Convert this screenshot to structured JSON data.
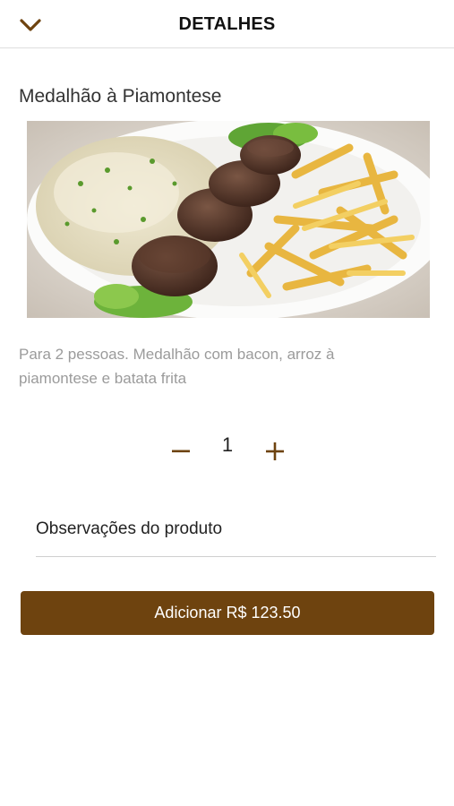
{
  "header": {
    "title": "DETALHES",
    "back_icon": "chevron-down-icon"
  },
  "product": {
    "name": "Medalhão à Piamontese",
    "description": "Para 2 pessoas. Medalhão com bacon, arroz à piamontese e batata frita",
    "image": "photo of medallions with risotto and fries"
  },
  "quantity": {
    "value": "1",
    "minus_icon": "minus-icon",
    "plus_icon": "plus-icon"
  },
  "observations": {
    "placeholder": "Observações do produto"
  },
  "add_button": {
    "label": "Adicionar",
    "price": "R$ 123.50"
  },
  "colors": {
    "accent": "#6e430f",
    "text": "#222222",
    "muted": "#9b9b9b"
  }
}
